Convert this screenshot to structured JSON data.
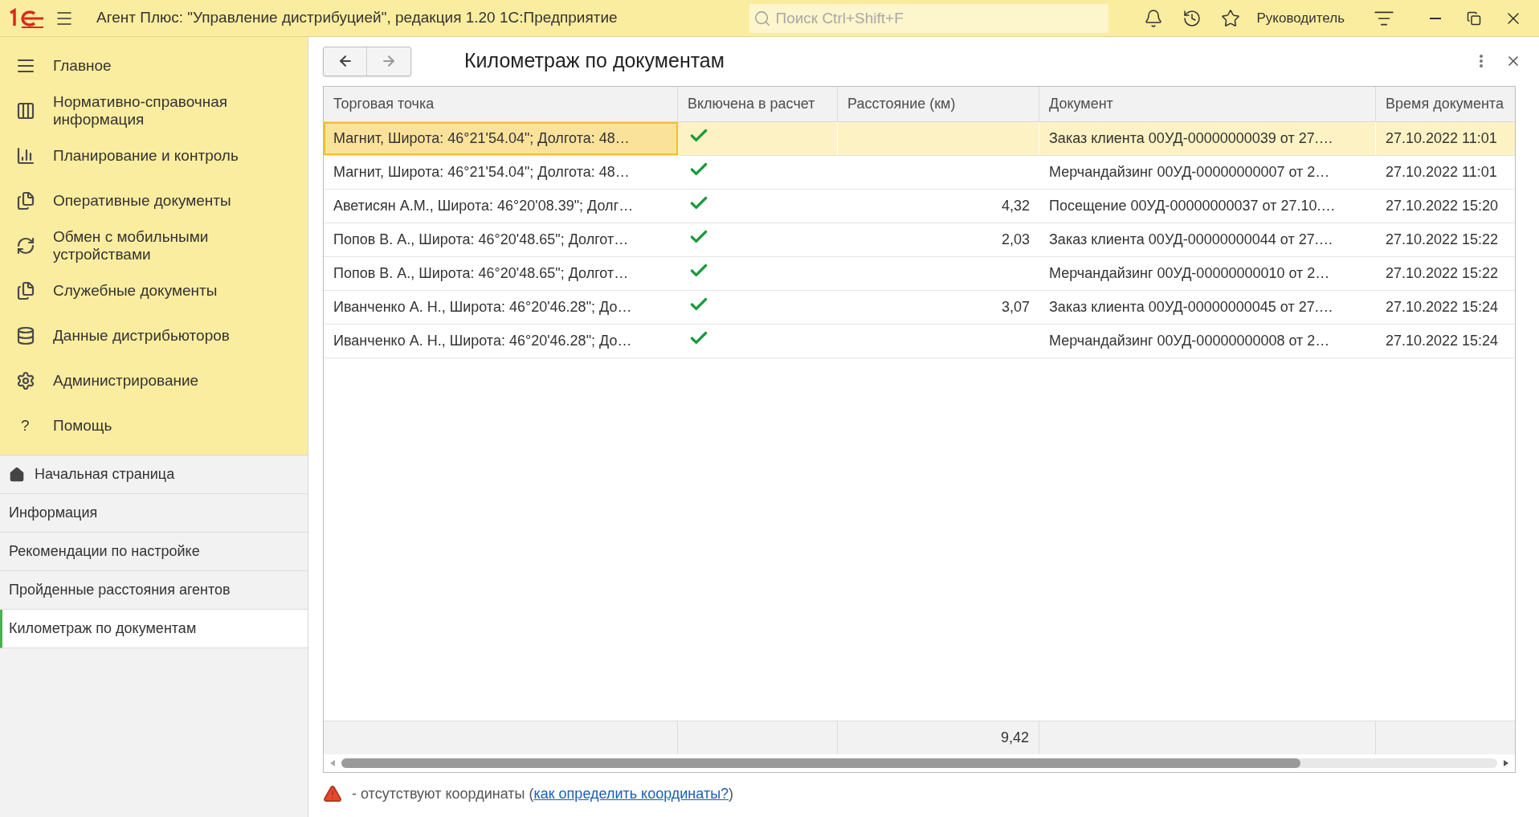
{
  "window": {
    "title": "Агент Плюс: \"Управление дистрибуцией\", редакция 1.20 1С:Предприятие"
  },
  "search": {
    "placeholder": "Поиск Ctrl+Shift+F"
  },
  "user": "Руководитель",
  "sections": [
    {
      "label": "Главное"
    },
    {
      "label": "Нормативно-справочная информация"
    },
    {
      "label": "Планирование и контроль"
    },
    {
      "label": "Оперативные документы"
    },
    {
      "label": "Обмен с мобильными устройствами"
    },
    {
      "label": "Служебные документы"
    },
    {
      "label": "Данные дистрибьюторов"
    },
    {
      "label": "Администрирование"
    },
    {
      "label": "Помощь",
      "icon_char": "?"
    }
  ],
  "open_windows": [
    {
      "label": "Начальная страница",
      "kind": "home",
      "selected": false
    },
    {
      "label": "Информация",
      "kind": "plain",
      "selected": false
    },
    {
      "label": "Рекомендации по настройке",
      "kind": "plain",
      "selected": false
    },
    {
      "label": "Пройденные расстояния агентов",
      "kind": "plain",
      "selected": false
    },
    {
      "label": "Километраж по документам",
      "kind": "plain",
      "selected": true
    }
  ],
  "form": {
    "title": "Километраж по документам",
    "table": {
      "columns": [
        "Торговая точка",
        "Включена в расчет",
        "Расстояние (км)",
        "Документ",
        "Время документа"
      ],
      "rows": [
        {
          "point": "Магнит, Широта: 46°21'54.04\"; Долгота: 48…",
          "included": true,
          "distance": "",
          "document": "Заказ клиента 00УД-00000000039 от 27.…",
          "time": "27.10.2022 11:01",
          "selected": true
        },
        {
          "point": "Магнит, Широта: 46°21'54.04\"; Долгота: 48…",
          "included": true,
          "distance": "",
          "document": "Мерчандайзинг 00УД-00000000007 от 2…",
          "time": "27.10.2022 11:01",
          "selected": false
        },
        {
          "point": "Аветисян А.М., Широта: 46°20'08.39\"; Долг…",
          "included": true,
          "distance": "4,32",
          "document": "Посещение 00УД-00000000037 от 27.10.…",
          "time": "27.10.2022 15:20",
          "selected": false
        },
        {
          "point": "Попов В. А., Широта: 46°20'48.65\"; Долгот…",
          "included": true,
          "distance": "2,03",
          "document": "Заказ клиента 00УД-00000000044 от 27.…",
          "time": "27.10.2022 15:22",
          "selected": false
        },
        {
          "point": "Попов В. А., Широта: 46°20'48.65\"; Долгот…",
          "included": true,
          "distance": "",
          "document": "Мерчандайзинг 00УД-00000000010 от 2…",
          "time": "27.10.2022 15:22",
          "selected": false
        },
        {
          "point": "Иванченко А. Н., Широта: 46°20'46.28\"; До…",
          "included": true,
          "distance": "3,07",
          "document": "Заказ клиента 00УД-00000000045 от 27.…",
          "time": "27.10.2022 15:24",
          "selected": false
        },
        {
          "point": "Иванченко А. Н., Широта: 46°20'46.28\"; До…",
          "included": true,
          "distance": "",
          "document": "Мерчандайзинг 00УД-00000000008 от 2…",
          "time": "27.10.2022 15:24",
          "selected": false
        }
      ],
      "total_distance": "9,42"
    },
    "note": {
      "text": "- отсутствуют координаты (",
      "link": "как определить координаты?",
      "tail": ")"
    }
  }
}
